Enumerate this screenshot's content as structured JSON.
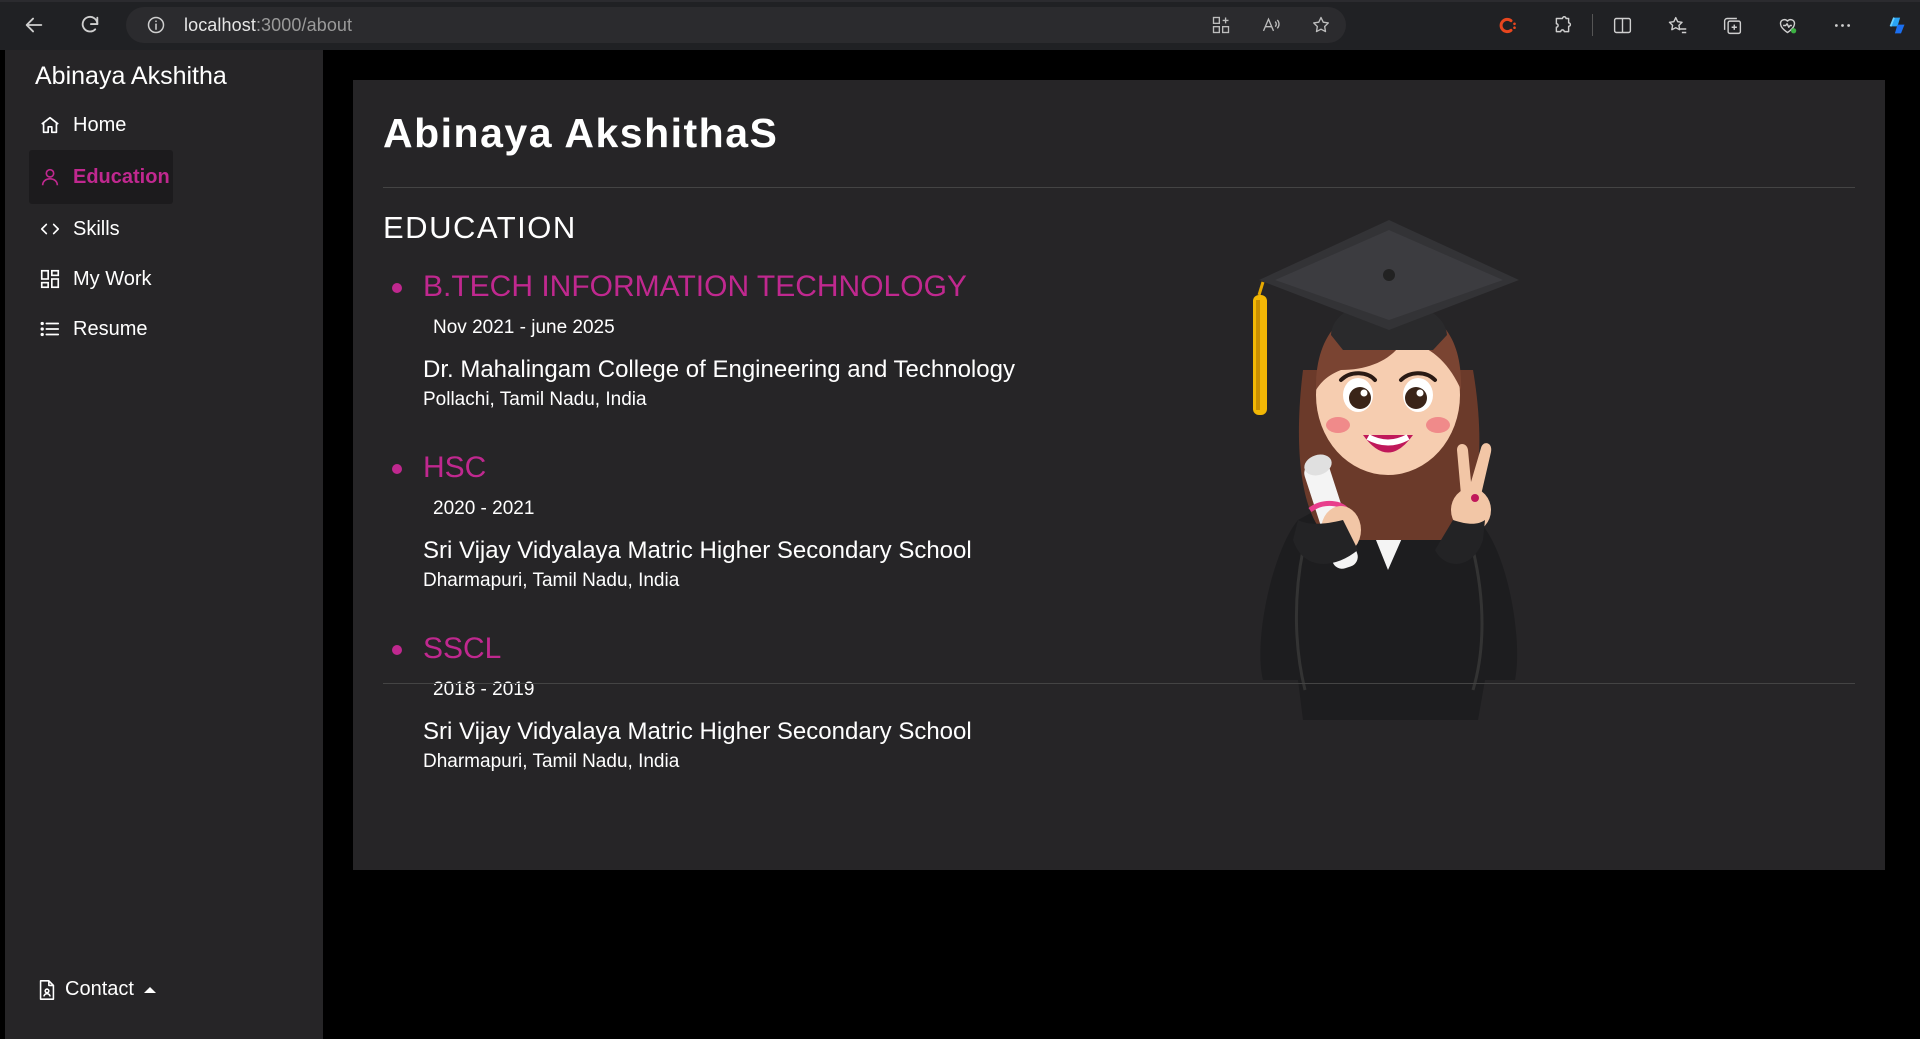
{
  "browser": {
    "url_host": "localhost",
    "url_path": ":3000/about"
  },
  "sidebar": {
    "brand": "Abinaya Akshitha",
    "items": [
      {
        "label": "Home",
        "icon": "home-icon",
        "active": false
      },
      {
        "label": "Education",
        "icon": "user-icon",
        "active": true
      },
      {
        "label": "Skills",
        "icon": "code-icon",
        "active": false
      },
      {
        "label": "My Work",
        "icon": "grid-icon",
        "active": false
      },
      {
        "label": "Resume",
        "icon": "list-icon",
        "active": false
      }
    ],
    "contact_label": "Contact"
  },
  "main": {
    "title": "Abinaya AkshithaS",
    "section_title": "EDUCATION",
    "education": [
      {
        "degree": "B.TECH INFORMATION TECHNOLOGY",
        "dates": "Nov 2021 - june 2025",
        "school": "Dr. Mahalingam College of Engineering and Technology",
        "location": "Pollachi, Tamil Nadu, India"
      },
      {
        "degree": "HSC",
        "dates": "2020 - 2021",
        "school": "Sri Vijay Vidyalaya Matric Higher Secondary School",
        "location": "Dharmapuri, Tamil Nadu, India"
      },
      {
        "degree": "SSCL",
        "dates": "2018 - 2019",
        "school": "Sri Vijay Vidyalaya Matric Higher Secondary School",
        "location": "Dharmapuri, Tamil Nadu, India"
      }
    ]
  },
  "colors": {
    "accent": "#c0288f",
    "sidebar_bg": "#262527",
    "card_bg": "#262527",
    "page_bg": "#000000"
  }
}
